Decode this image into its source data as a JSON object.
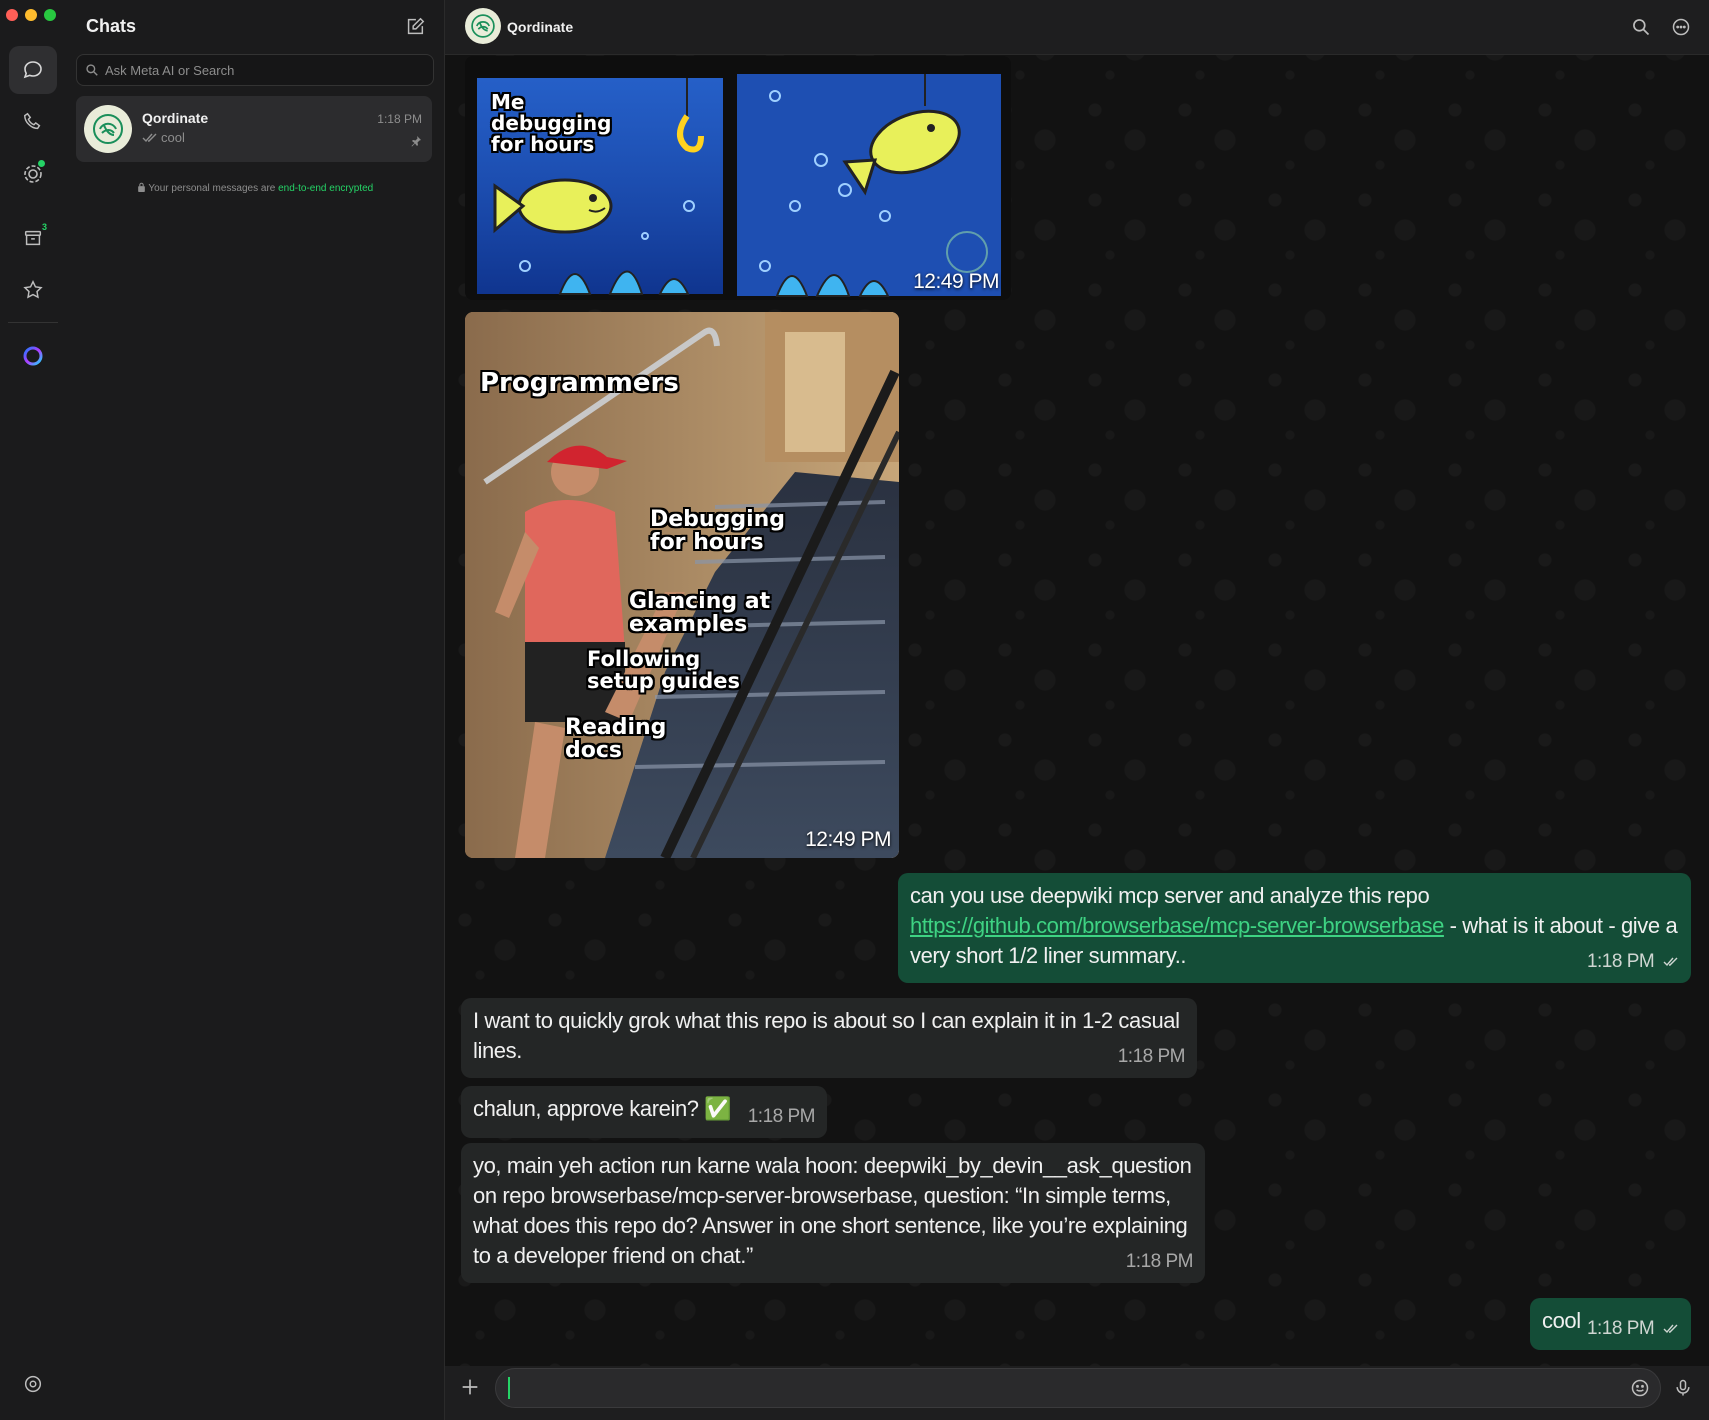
{
  "window": {
    "controls": [
      "close",
      "minimize",
      "zoom"
    ]
  },
  "rail": {
    "items": [
      {
        "name": "chats-icon",
        "active": true
      },
      {
        "name": "calls-icon"
      },
      {
        "name": "status-icon",
        "dot": true
      },
      {
        "name": "archive-icon",
        "badge": "3"
      },
      {
        "name": "starred-icon"
      },
      {
        "name": "meta-ai-icon"
      },
      {
        "name": "settings-icon"
      }
    ],
    "archive_badge": "3"
  },
  "chatlist": {
    "title": "Chats",
    "search_placeholder": "Ask Meta AI or Search",
    "items": [
      {
        "name": "Qordinate",
        "time": "1:18 PM",
        "preview": "cool",
        "pinned": true
      }
    ],
    "encryption_prefix": "Your personal messages are ",
    "encryption_link": "end-to-end encrypted"
  },
  "conversation": {
    "contact_name": "Qordinate",
    "messages": [
      {
        "type": "image",
        "direction": "in",
        "description_text": [
          "Me debugging for hours"
        ],
        "time": "12:49 PM"
      },
      {
        "type": "image",
        "direction": "in",
        "captions": [
          "Programmers",
          "Debugging for hours",
          "Glancing at examples",
          "Following setup guides",
          "Reading docs"
        ],
        "time": "12:49 PM"
      },
      {
        "type": "text",
        "direction": "out",
        "text_before": "can you use deepwiki mcp server and analyze this repo ",
        "link": "https://github.com/browserbase/mcp-server-browserbase",
        "text_after": " - what is it about - give a very short 1/2 liner summary..",
        "time": "1:18 PM"
      },
      {
        "type": "text",
        "direction": "in",
        "text": "I want to quickly grok what this repo is about so I can explain it in 1-2 casual lines.",
        "time": "1:18 PM"
      },
      {
        "type": "text",
        "direction": "in",
        "text": "chalun, approve karein? ✅",
        "time": "1:18 PM"
      },
      {
        "type": "text",
        "direction": "in",
        "text": "yo, main yeh action run karne wala hoon: deepwiki_by_devin__ask_question on repo browserbase/mcp-server-browserbase, question: “In simple terms, what does this repo do? Answer in one short sentence, like you’re explaining to a developer friend on chat.”",
        "time": "1:18 PM"
      },
      {
        "type": "text",
        "direction": "out",
        "text": "cool",
        "time": "1:18 PM"
      }
    ],
    "meme1": {
      "left_text": "Me debugging for hours"
    },
    "meme2": {
      "title": "Programmers",
      "step1": "Debugging for hours",
      "step2": "Glancing at examples",
      "step3": "Following setup guides",
      "step4": "Reading docs"
    }
  },
  "colors": {
    "accent": "#25d366",
    "outgoing_bubble": "#144d37",
    "incoming_bubble": "#242626",
    "link": "#3ed383"
  }
}
